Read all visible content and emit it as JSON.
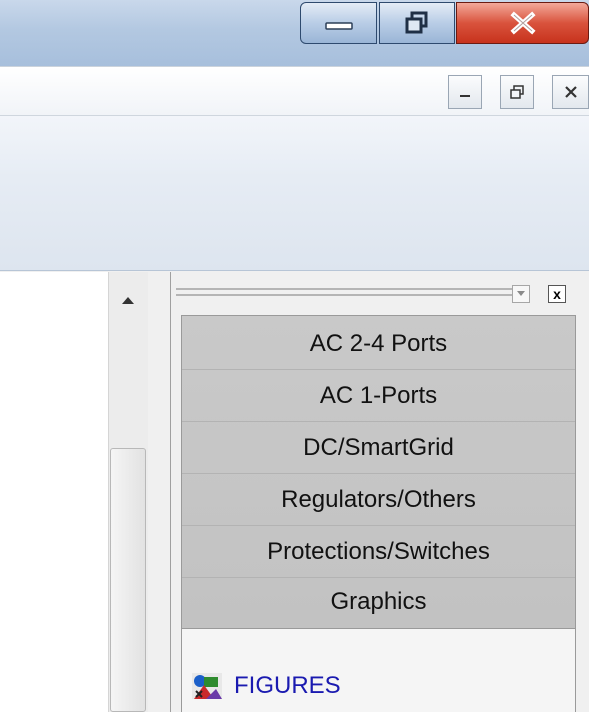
{
  "window": {
    "controls": {
      "minimize_icon": "minimize-icon",
      "restore_icon": "restore-icon",
      "close_icon": "close-icon"
    }
  },
  "mdi": {
    "controls": {
      "minimize_icon": "minimize-icon",
      "restore_icon": "restore-icon",
      "close_icon": "close-icon"
    }
  },
  "library_panel": {
    "close_label": "x",
    "categories": [
      {
        "label": "AC 2-4 Ports"
      },
      {
        "label": "AC 1-Ports"
      },
      {
        "label": "DC/SmartGrid"
      },
      {
        "label": "Regulators/Others"
      },
      {
        "label": "Protections/Switches"
      },
      {
        "label": "Graphics"
      }
    ],
    "figures": {
      "label": "FIGURES",
      "icon": "figures-icon"
    }
  },
  "colors": {
    "title_bar": "#b3c8e1",
    "close_button": "#d9533d",
    "list_background": "#c6c6c6",
    "figures_text": "#1a1ab0"
  }
}
